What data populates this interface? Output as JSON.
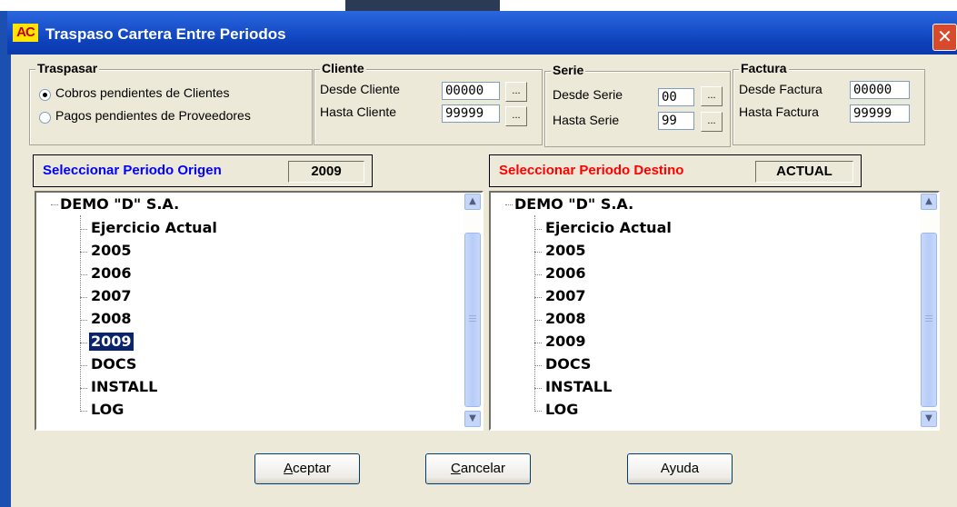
{
  "window": {
    "icon_text": "AC",
    "title": "Traspaso Cartera Entre Periodos",
    "close_glyph": "✕"
  },
  "traspasar": {
    "legend": "Traspasar",
    "options": [
      {
        "label": "Cobros pendientes de Clientes",
        "selected": true
      },
      {
        "label": "Pagos pendientes de Proveedores",
        "selected": false
      }
    ]
  },
  "cliente": {
    "legend": "Cliente",
    "desde_label": "Desde Cliente",
    "desde_value": "00000",
    "hasta_label": "Hasta Cliente",
    "hasta_value": "99999",
    "ellipsis": "..."
  },
  "serie": {
    "legend": "Serie",
    "desde_label": "Desde Serie",
    "desde_value": "00",
    "hasta_label": "Hasta Serie",
    "hasta_value": "99",
    "ellipsis": "..."
  },
  "factura": {
    "legend": "Factura",
    "desde_label": "Desde Factura",
    "desde_value": "00000",
    "hasta_label": "Hasta Factura",
    "hasta_value": "99999"
  },
  "origen": {
    "label": "Seleccionar Periodo Origen",
    "label_color": "#0000ff",
    "value": "2009",
    "tree": {
      "root": "DEMO \"D\" S.A.",
      "children": [
        "Ejercicio Actual",
        "2005",
        "2006",
        "2007",
        "2008",
        "2009",
        "DOCS",
        "INSTALL",
        "LOG"
      ],
      "selected": "2009"
    }
  },
  "destino": {
    "label": "Seleccionar Periodo Destino",
    "label_color": "#ff0000",
    "value": "ACTUAL",
    "tree": {
      "root": "DEMO \"D\" S.A.",
      "children": [
        "Ejercicio Actual",
        "2005",
        "2006",
        "2007",
        "2008",
        "2009",
        "DOCS",
        "INSTALL",
        "LOG"
      ]
    }
  },
  "buttons": {
    "aceptar_mnemonic": "A",
    "aceptar_rest": "ceptar",
    "cancelar_mnemonic": "C",
    "cancelar_rest": "ancelar",
    "ayuda": "Ayuda"
  },
  "icons": {
    "scroll_up": "▲",
    "scroll_down": "▼"
  }
}
